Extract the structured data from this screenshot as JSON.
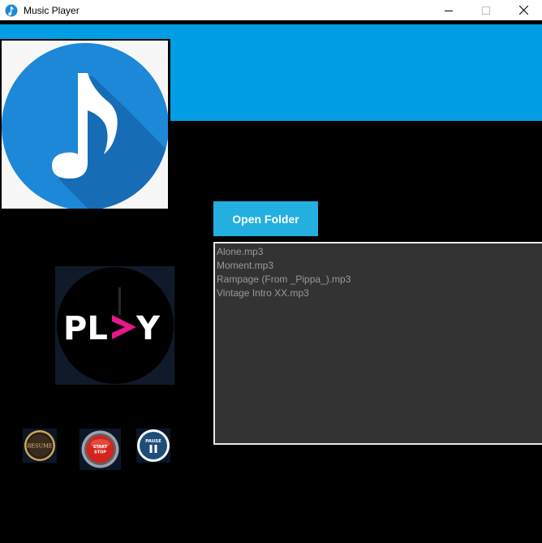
{
  "window": {
    "title": "Music Player",
    "controls": {
      "minimize": "minimize",
      "maximize": "maximize",
      "close": "close"
    }
  },
  "colors": {
    "header_blue": "#019ee3",
    "button_blue": "#23afe0",
    "playlist_bg": "#333333",
    "playlist_text": "#9a9a9a",
    "logo_circle": "#1e88d8",
    "play_accent": "#e6198a"
  },
  "logo": {
    "icon": "music-note-icon"
  },
  "play_art": {
    "text_left": "PL",
    "text_right": "Y",
    "icon": "play-logo"
  },
  "controls": {
    "resume_label": "RESUME",
    "start_label": "START",
    "stop_label": "STOP",
    "pause_label": "PAUSE"
  },
  "open_folder_label": "Open Folder",
  "playlist": {
    "items": [
      "Alone.mp3",
      "Moment.mp3",
      "Rampage (From _Pippa_).mp3",
      "Vintage Intro XX.mp3"
    ]
  }
}
